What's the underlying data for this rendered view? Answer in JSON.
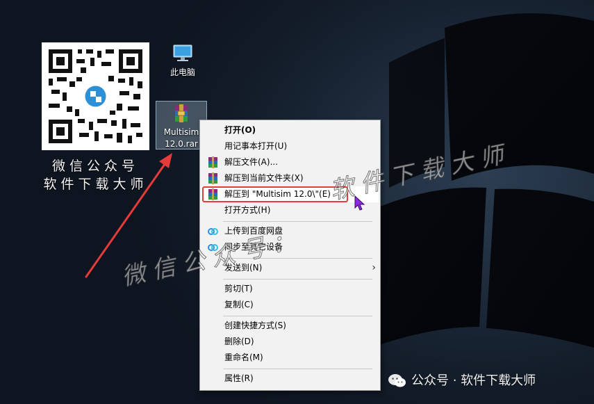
{
  "desktop": {
    "icons": [
      {
        "label": "此电脑"
      },
      {
        "label_line1": "Multisim",
        "label_line2": "12.0.rar"
      }
    ]
  },
  "qr_caption": {
    "line1": "微信公众号",
    "line2": "软件下载大师"
  },
  "context_menu": {
    "items": [
      {
        "label": "打开(O)"
      },
      {
        "label": "用记事本打开(U)"
      },
      {
        "label": "解压文件(A)..."
      },
      {
        "label": "解压到当前文件夹(X)"
      },
      {
        "label": "解压到 \"Multisim 12.0\\\"(E)"
      },
      {
        "label": "打开方式(H)"
      },
      {
        "label": "上传到百度网盘"
      },
      {
        "label": "同步至其它设备"
      },
      {
        "label": "发送到(N)"
      },
      {
        "label": "剪切(T)"
      },
      {
        "label": "复制(C)"
      },
      {
        "label": "创建快捷方式(S)"
      },
      {
        "label": "删除(D)"
      },
      {
        "label": "重命名(M)"
      },
      {
        "label": "属性(R)"
      }
    ],
    "icons": {
      "winrar": "winrar-icon",
      "baidu": "baidu-netdisk-icon",
      "submenu": "chevron-right-icon"
    }
  },
  "watermark": {
    "left": "微信公众号：",
    "right": "软件下载大师"
  },
  "footer": {
    "text": "公众号 · 软件下载大师"
  },
  "colors": {
    "highlight_border": "#e53b3b",
    "menu_bg": "#f2f2f2",
    "arrow": "#e53b3b"
  }
}
